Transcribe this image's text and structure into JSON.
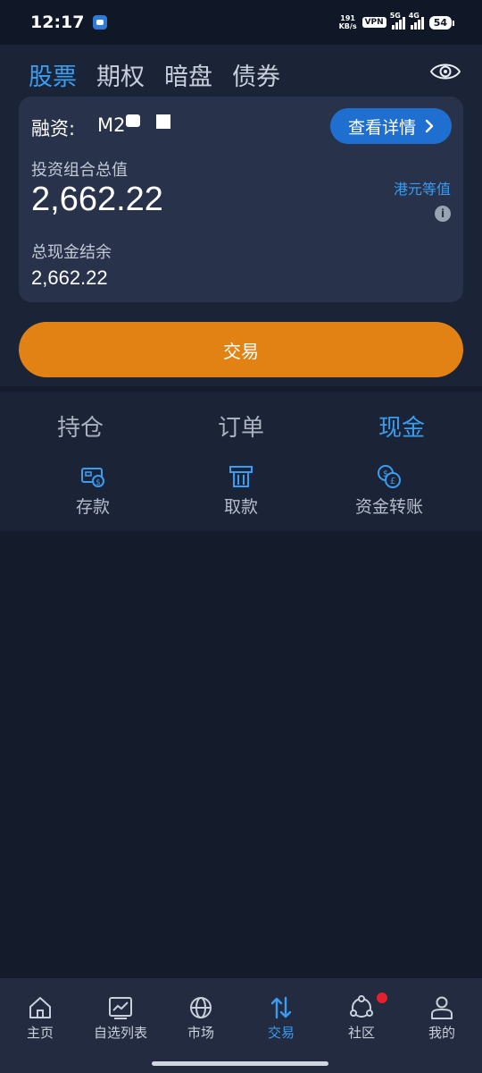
{
  "status_bar": {
    "time": "12:17",
    "net_speed_value": "191",
    "net_speed_unit": "KB/s",
    "vpn": "VPN",
    "signal_1": "5G",
    "signal_2": "4G",
    "battery": "54"
  },
  "tabs": [
    {
      "label": "股票",
      "active": true
    },
    {
      "label": "期权",
      "active": false
    },
    {
      "label": "暗盘",
      "active": false
    },
    {
      "label": "债券",
      "active": false
    }
  ],
  "account": {
    "label": "融资:",
    "id_visible": "M2",
    "detail_button": "查看详情",
    "portfolio_label": "投资组合总值",
    "portfolio_value": "2,662.22",
    "currency_label": "港元等值",
    "cash_label": "总现金结余",
    "cash_value": "2,662.22"
  },
  "trade_button": "交易",
  "sub_tabs": [
    {
      "label": "持仓",
      "active": false
    },
    {
      "label": "订单",
      "active": false
    },
    {
      "label": "现金",
      "active": true
    }
  ],
  "cash_actions": [
    {
      "label": "存款",
      "icon": "deposit-icon"
    },
    {
      "label": "取款",
      "icon": "withdraw-icon"
    },
    {
      "label": "资金转账",
      "icon": "fund-transfer-icon"
    }
  ],
  "bottom_nav": [
    {
      "label": "主页",
      "icon": "home-icon",
      "active": false
    },
    {
      "label": "自选列表",
      "icon": "watchlist-icon",
      "active": false
    },
    {
      "label": "市场",
      "icon": "globe-icon",
      "active": false
    },
    {
      "label": "交易",
      "icon": "trade-arrows-icon",
      "active": true
    },
    {
      "label": "社区",
      "icon": "community-icon",
      "active": false
    },
    {
      "label": "我的",
      "icon": "profile-icon",
      "active": false
    }
  ],
  "colors": {
    "accent": "#3a9df2",
    "trade_button": "#e28214",
    "detail_button": "#1f6fd0",
    "background": "#141b2b",
    "card": "#28324b",
    "notification": "#e5202e"
  }
}
